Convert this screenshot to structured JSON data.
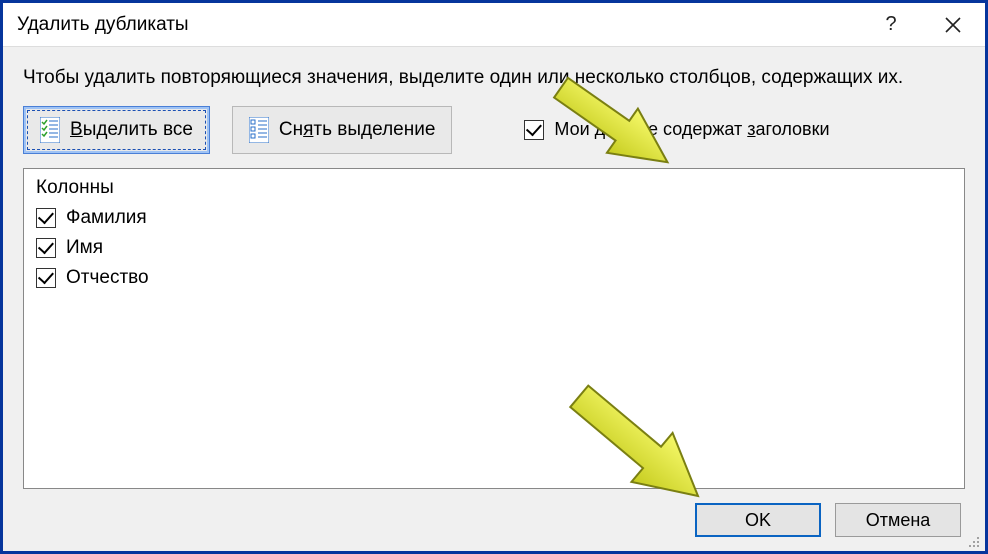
{
  "titlebar": {
    "title": "Удалить дубликаты"
  },
  "instruction": "Чтобы удалить повторяющиеся значения, выделите один или несколько столбцов, содержащих их.",
  "toolbar": {
    "select_all": {
      "pre": "",
      "u": "В",
      "post": "ыделить все"
    },
    "unselect_all": {
      "pre": "Сн",
      "u": "я",
      "post": "ть выделение"
    }
  },
  "headers_checkbox": {
    "checked": true,
    "pre": "Мои данные содержат ",
    "u": "з",
    "post": "аголовки"
  },
  "columns": {
    "header": "Колонны",
    "items": [
      {
        "label": "Фамилия",
        "checked": true
      },
      {
        "label": "Имя",
        "checked": true
      },
      {
        "label": "Отчество",
        "checked": true
      }
    ]
  },
  "footer": {
    "ok": "OK",
    "cancel": "Отмена"
  }
}
